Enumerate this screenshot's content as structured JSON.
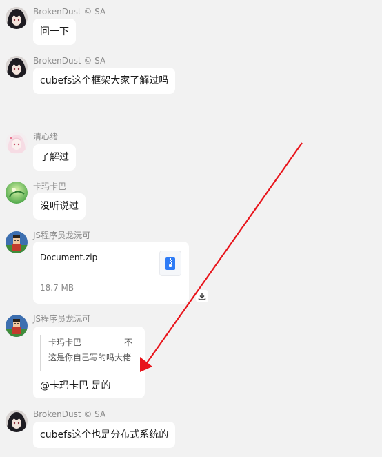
{
  "messages": [
    {
      "user": "BrokenDust © SA",
      "text": "问一下"
    },
    {
      "user": "BrokenDust © SA",
      "text": "cubefs这个框架大家了解过吗"
    },
    {
      "user": "清心绪",
      "text": "了解过"
    },
    {
      "user": "卡玛卡巴",
      "text": "没听说过"
    },
    {
      "user": "JS程序员龙沅可",
      "file": {
        "name": "Document.zip",
        "size": "18.7 MB"
      }
    },
    {
      "user": "JS程序员龙沅可",
      "quote": {
        "name": "卡玛卡巴",
        "close": "不",
        "text": "这是你自己写的吗大佬"
      },
      "text": "@卡玛卡巴 是的"
    },
    {
      "user": "BrokenDust © SA",
      "text": "cubefs这个也是分布式系统的"
    }
  ],
  "colors": {
    "annotation_arrow": "#e8141b",
    "file_icon": "#2f7cf6"
  }
}
